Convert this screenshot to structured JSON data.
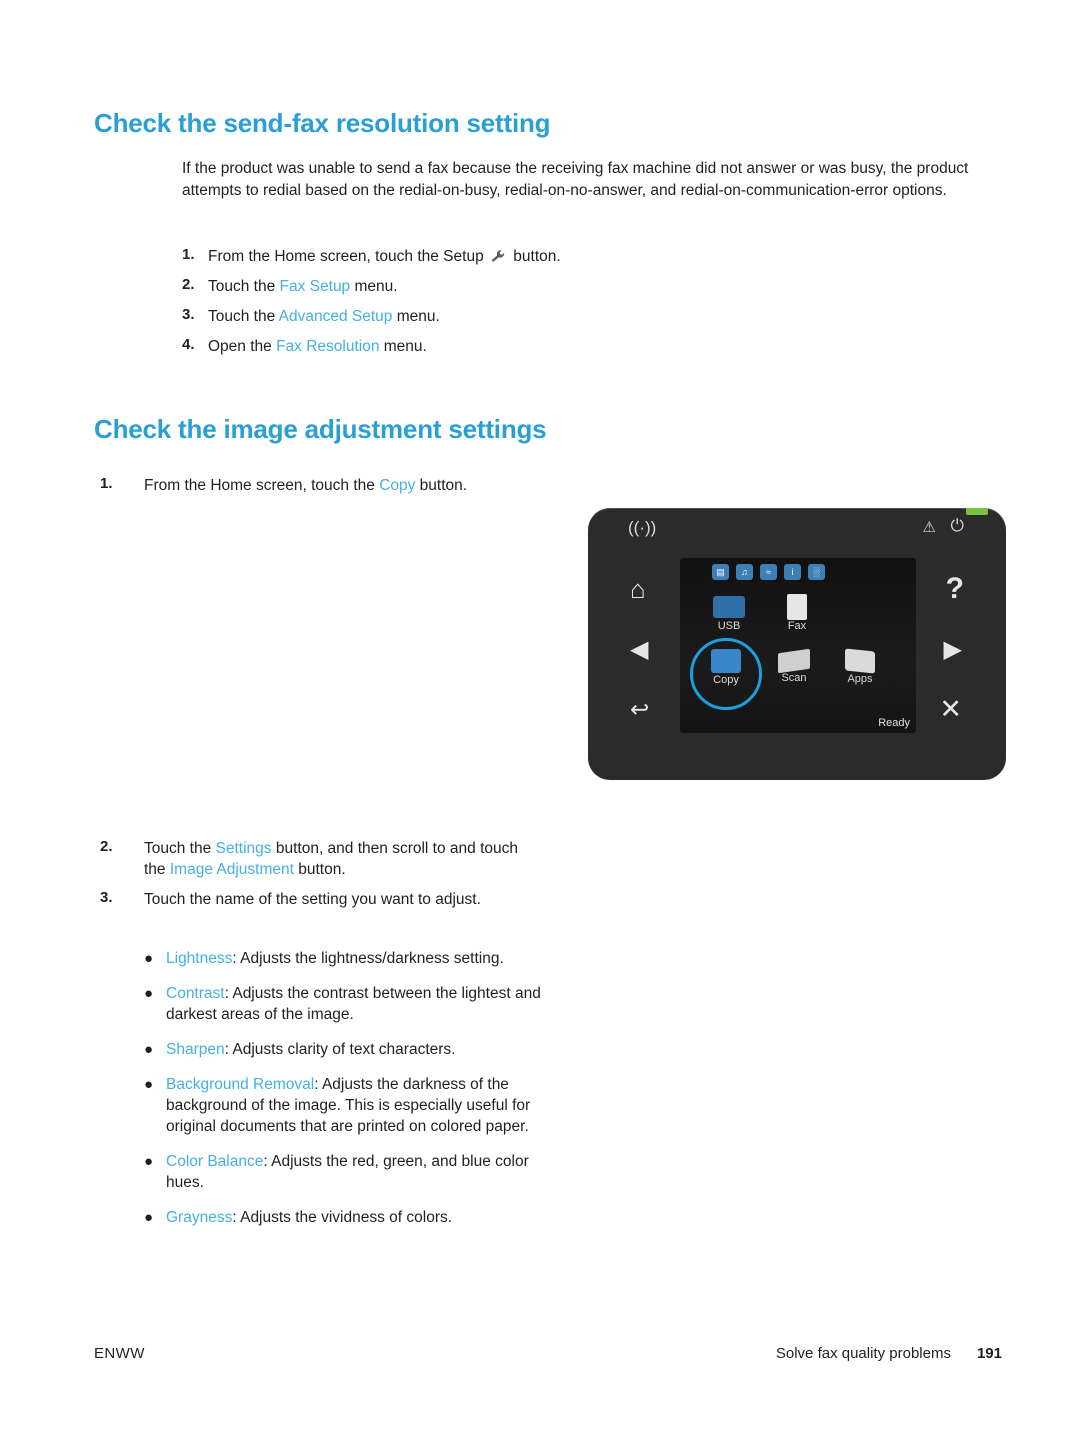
{
  "document": {
    "headings": {
      "send_fax": "Check the send-fax resolution setting",
      "image_adjustment": "Check the image adjustment settings"
    },
    "intro_paragraph": "If the product was unable to send a fax because the receiving fax machine did not answer or was busy, the product attempts to redial based on the redial-on-busy, redial-on-no-answer, and redial-on-communication-error options.",
    "send_fax_steps": [
      {
        "num": "1.",
        "pre": "From the Home screen, touch the Setup ",
        "link": "",
        "post": " button."
      },
      {
        "num": "2.",
        "pre": "Touch the ",
        "link": "Fax Setup",
        "post": " menu."
      },
      {
        "num": "3.",
        "pre": "Touch the ",
        "link": "Advanced Setup",
        "post": " menu."
      },
      {
        "num": "4.",
        "pre": "Open the ",
        "link": "Fax Resolution",
        "post": " menu."
      }
    ],
    "image_steps_first": [
      {
        "num": "1.",
        "pre": "From the Home screen, touch the ",
        "link": "Copy",
        "post": " button."
      }
    ],
    "image_steps_rest": [
      {
        "num": "2.",
        "pre": "Touch the ",
        "link": "Settings",
        "post": " button, and then scroll to and touch the ",
        "link2": "Image Adjustment",
        "post2": " button."
      },
      {
        "num": "3.",
        "pre": "Touch the name of the setting you want to adjust.",
        "link": "",
        "post": ""
      }
    ],
    "bullets": [
      {
        "term": "Lightness",
        "desc": ": Adjusts the lightness/darkness setting."
      },
      {
        "term": "Contrast",
        "desc": ": Adjusts the contrast between the lightest and darkest areas of the image."
      },
      {
        "term": "Sharpen",
        "desc": ": Adjusts clarity of text characters."
      },
      {
        "term": "Background Removal",
        "desc": ": Adjusts the darkness of the background of the image. This is especially useful for original documents that are printed on colored paper."
      },
      {
        "term": "Color Balance",
        "desc": ": Adjusts the red, green, and blue color hues."
      },
      {
        "term": "Grayness",
        "desc": ": Adjusts the vividness of colors."
      }
    ],
    "footer": {
      "left": "ENWW",
      "right": "Solve fax quality problems",
      "page": "191"
    }
  },
  "control_panel": {
    "top_icons": {
      "wireless": "((·))",
      "warning": "⚠",
      "power": "⏻"
    },
    "nav_buttons": {
      "home": "⌂",
      "left": "◀",
      "back": "↩",
      "help": "?",
      "right": "▶",
      "cancel": "✕"
    },
    "screen": {
      "status_icons": [
        "▤",
        "♫",
        "≈",
        "i",
        "░"
      ],
      "tiles": [
        {
          "label": "USB"
        },
        {
          "label": "Fax"
        },
        {
          "label": "Copy"
        },
        {
          "label": "Scan"
        },
        {
          "label": "Apps"
        }
      ],
      "status_text": "Ready",
      "highlight_target": "Copy"
    },
    "colors": {
      "accent_blue": "#45b0e3",
      "heading_blue": "#2a9fd6",
      "panel_body": "#2b2b2b",
      "green_led": "#7ac143"
    }
  }
}
